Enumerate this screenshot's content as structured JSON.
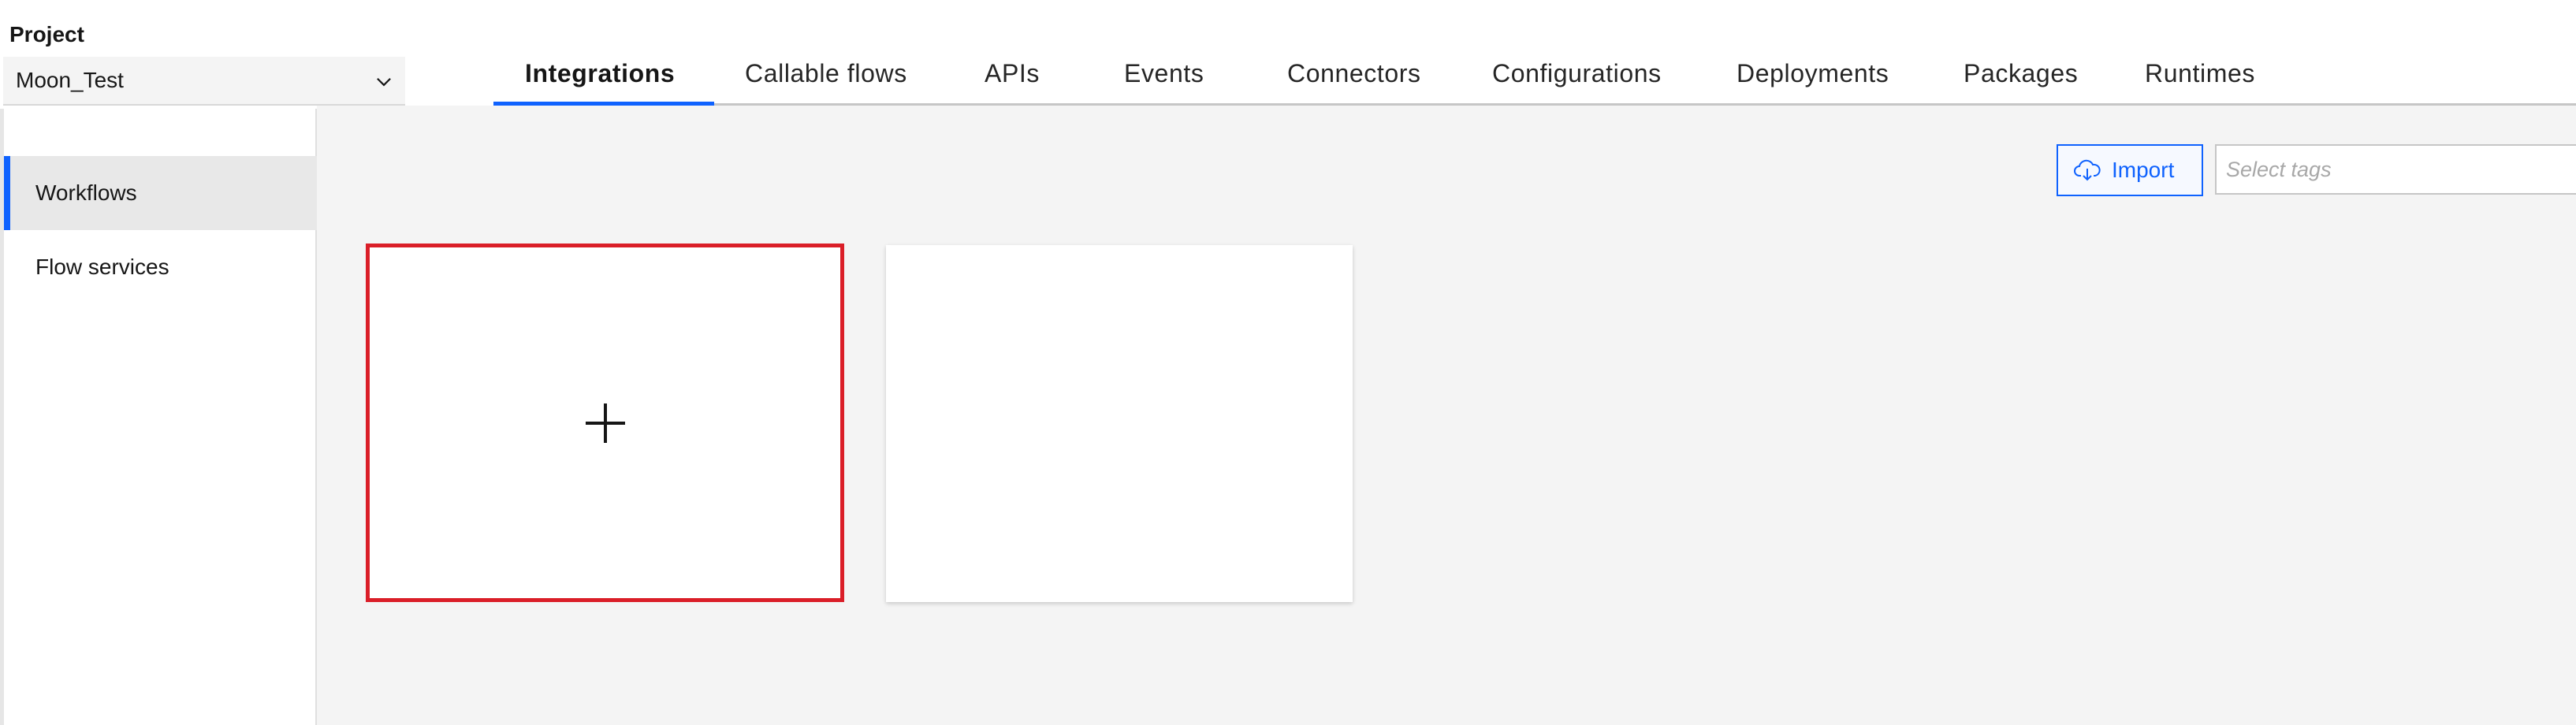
{
  "project": {
    "label": "Project",
    "selected": "Moon_Test"
  },
  "tabs": [
    {
      "label": "Integrations",
      "active": true
    },
    {
      "label": "Callable flows",
      "active": false
    },
    {
      "label": "APIs",
      "active": false
    },
    {
      "label": "Events",
      "active": false
    },
    {
      "label": "Connectors",
      "active": false
    },
    {
      "label": "Configurations",
      "active": false
    },
    {
      "label": "Deployments",
      "active": false
    },
    {
      "label": "Packages",
      "active": false
    },
    {
      "label": "Runtimes",
      "active": false
    }
  ],
  "sidebar": {
    "items": [
      {
        "label": "Workflows",
        "active": true
      },
      {
        "label": "Flow services",
        "active": false
      }
    ]
  },
  "toolbar": {
    "import_label": "Import",
    "tags_placeholder": "Select tags"
  },
  "cards": {
    "add_icon": "plus-icon"
  },
  "colors": {
    "accent": "#0f62fe",
    "highlight": "#da1e28",
    "content_bg": "#f4f4f4"
  }
}
